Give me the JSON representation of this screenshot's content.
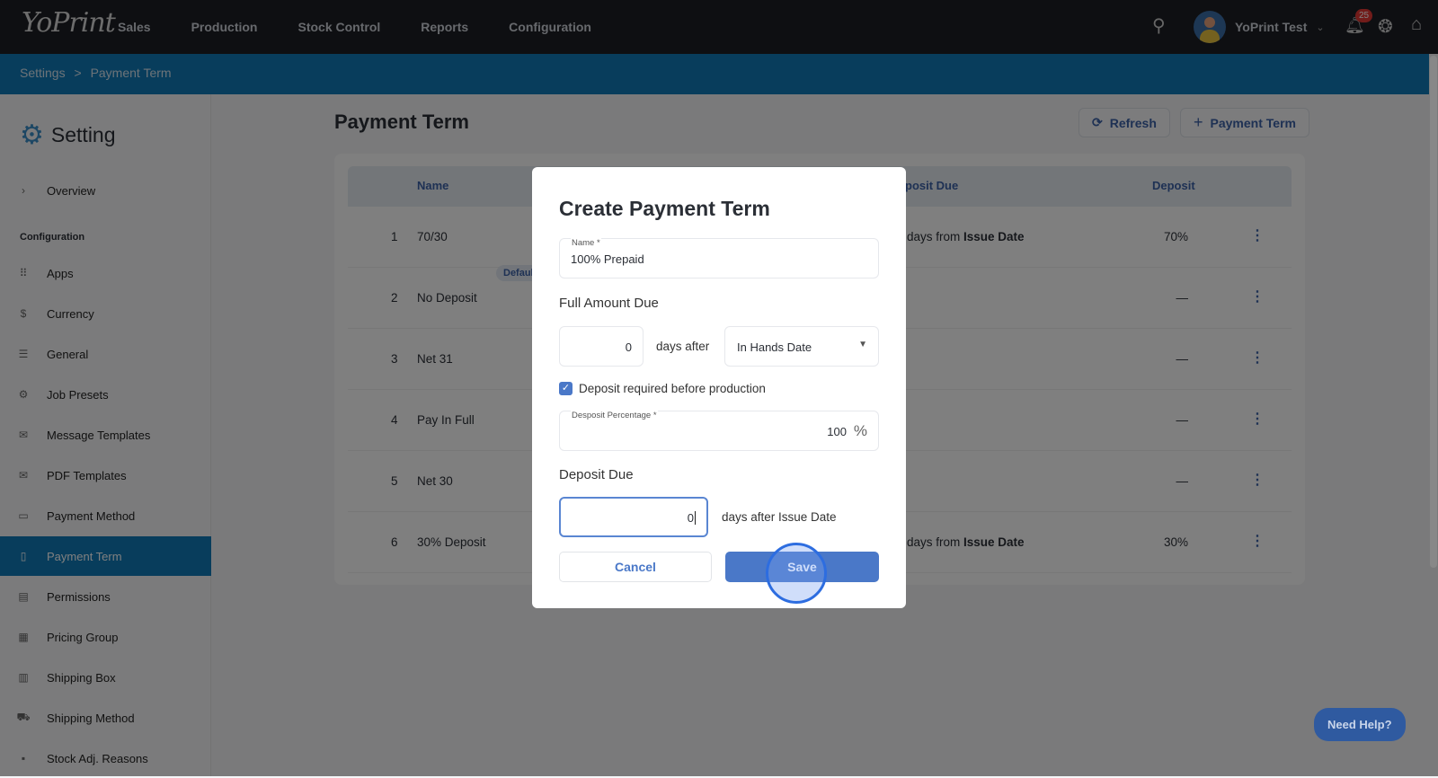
{
  "app": {
    "logo": "YoPrint",
    "nav": [
      "Sales",
      "Production",
      "Stock Control",
      "Reports",
      "Configuration"
    ],
    "user": "YoPrint Test",
    "notifications": "25"
  },
  "breadcrumb": {
    "parent": "Settings",
    "separator": ">",
    "current": "Payment Term"
  },
  "sidebar": {
    "title": "Setting",
    "overview": "Overview",
    "section": "Configuration",
    "items": [
      {
        "label": "Apps",
        "icon": "⠿"
      },
      {
        "label": "Currency",
        "icon": "$"
      },
      {
        "label": "General",
        "icon": "☰"
      },
      {
        "label": "Job Presets",
        "icon": "⚙"
      },
      {
        "label": "Message Templates",
        "icon": "✉"
      },
      {
        "label": "PDF Templates",
        "icon": "✉"
      },
      {
        "label": "Payment Method",
        "icon": "▭"
      },
      {
        "label": "Payment Term",
        "icon": "▯"
      },
      {
        "label": "Permissions",
        "icon": "▤"
      },
      {
        "label": "Pricing Group",
        "icon": "▦"
      },
      {
        "label": "Shipping Box",
        "icon": "▥"
      },
      {
        "label": "Shipping Method",
        "icon": "⛟"
      },
      {
        "label": "Stock Adj. Reasons",
        "icon": "▪"
      }
    ],
    "active": "Payment Term"
  },
  "page": {
    "title": "Payment Term",
    "refresh": "Refresh",
    "add": "Payment Term"
  },
  "table": {
    "headers": {
      "name": "Name",
      "deposit_due": "posit Due",
      "deposit": "Deposit"
    },
    "rows": [
      {
        "n": "1",
        "name": "70/30",
        "due_prefix": "days from ",
        "due_bold": "Issue Date",
        "deposit": "70%"
      },
      {
        "n": "2",
        "name": "No Deposit",
        "badge": "Default",
        "deposit": "—"
      },
      {
        "n": "3",
        "name": "Net 31",
        "deposit": "—"
      },
      {
        "n": "4",
        "name": "Pay In Full",
        "deposit": "—"
      },
      {
        "n": "5",
        "name": "Net 30",
        "deposit": "—"
      },
      {
        "n": "6",
        "name": "30% Deposit",
        "due_prefix": "days from ",
        "due_bold": "Issue Date",
        "deposit": "30%"
      }
    ]
  },
  "modal": {
    "title": "Create Payment Term",
    "name_label": "Name *",
    "name_value": "100% Prepaid",
    "full_amount_due": "Full Amount Due",
    "full_days": "0",
    "days_after": "days after",
    "date_select": "In Hands Date",
    "deposit_checkbox": "Deposit required before production",
    "deposit_pct_label": "Desposit Percentage *",
    "deposit_pct": "100",
    "pct_symbol": "%",
    "deposit_due": "Deposit Due",
    "deposit_days": "0",
    "deposit_days_after": "days after Issue Date",
    "cancel": "Cancel",
    "save": "Save"
  },
  "help": "Need Help?"
}
